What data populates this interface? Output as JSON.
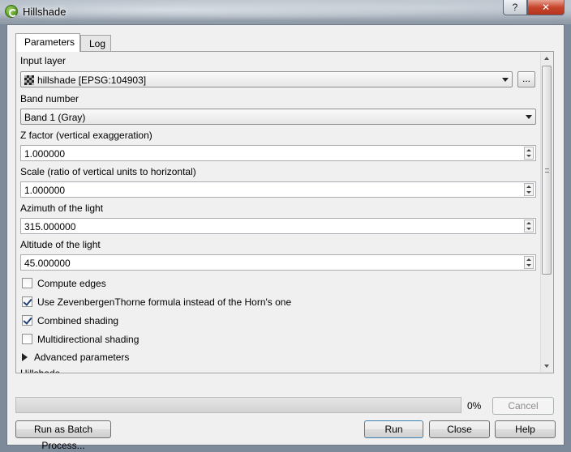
{
  "window": {
    "title": "Hillshade",
    "help_glyph": "?",
    "close_glyph": "✕"
  },
  "tabs": [
    {
      "label": "Parameters"
    },
    {
      "label": "Log"
    }
  ],
  "params": {
    "input_layer_label": "Input layer",
    "input_layer_value": "hillshade [EPSG:104903]",
    "browse_label": "...",
    "band_label": "Band number",
    "band_value": "Band 1 (Gray)",
    "z_factor_label": "Z factor (vertical exaggeration)",
    "z_factor_value": "1.000000",
    "scale_label": "Scale (ratio of vertical units to horizontal)",
    "scale_value": "1.000000",
    "azimuth_label": "Azimuth of the light",
    "azimuth_value": "315.000000",
    "altitude_label": "Altitude of the light",
    "altitude_value": "45.000000",
    "compute_edges_label": "Compute edges",
    "zevenbergen_label": "Use ZevenbergenThorne formula instead of the Horn's one",
    "combined_label": "Combined shading",
    "multidirectional_label": "Multidirectional shading",
    "advanced_label": "Advanced parameters",
    "output_label_partial": "Hillshade"
  },
  "checks": {
    "compute_edges": false,
    "zevenbergen": true,
    "combined": true,
    "multidirectional": false
  },
  "footer": {
    "progress_text": "0%",
    "progress": 0,
    "cancel_label": "Cancel",
    "batch_label": "Run as Batch Process...",
    "run_label": "Run",
    "close_label": "Close",
    "help_label": "Help"
  }
}
